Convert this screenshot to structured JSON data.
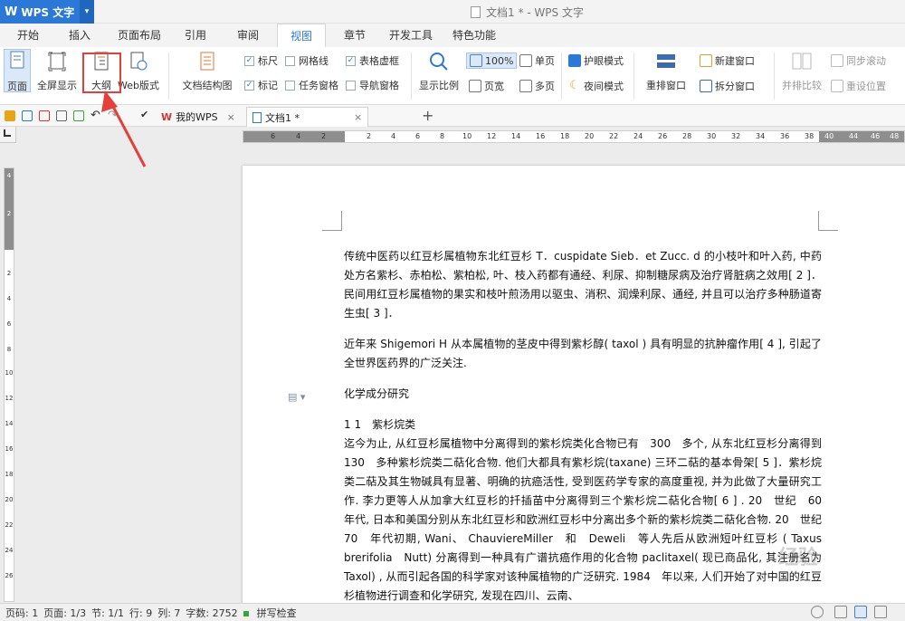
{
  "app": {
    "name": "WPS 文字",
    "window_title": "文档1 * - WPS 文字"
  },
  "tabs": [
    "开始",
    "插入",
    "页面布局",
    "引用",
    "审阅",
    "视图",
    "章节",
    "开发工具",
    "特色功能"
  ],
  "ribbon": {
    "page_view": "页面",
    "fullscreen": "全屏显示",
    "outline": "大纲",
    "web_layout": "Web版式",
    "doc_map": "文档结构图",
    "ruler": "标尺",
    "gridlines": "网格线",
    "table_gridlines": "表格虚框",
    "marks": "标记",
    "task_pane": "任务窗格",
    "nav_pane": "导航窗格",
    "zoom_ratio": "显示比例",
    "zoom_100": "100%",
    "page_width": "页宽",
    "single_page": "单页",
    "multi_page": "多页",
    "eye_protect": "护眼模式",
    "night_mode": "夜间模式",
    "rearrange": "重排窗口",
    "new_window": "新建窗口",
    "split_window": "拆分窗口",
    "side_by_side": "并排比较",
    "sync_scroll": "同步滚动",
    "reset_pos": "重设位置"
  },
  "quickbar": {
    "tab1": "我的WPS",
    "tab2": "文档1 *",
    "close": "×",
    "add": "+"
  },
  "ruler": {
    "h_numbers": [
      "6",
      "4",
      "2",
      "2",
      "4",
      "6",
      "8",
      "10",
      "12",
      "14",
      "16",
      "18",
      "20",
      "22",
      "24",
      "26",
      "28",
      "30",
      "32",
      "34",
      "36",
      "38",
      "40",
      "44",
      "46",
      "48"
    ],
    "v_numbers": [
      "4",
      "2",
      "2",
      "4",
      "6",
      "8",
      "10",
      "12",
      "14",
      "16",
      "18",
      "20",
      "22",
      "24",
      "26"
    ]
  },
  "document": {
    "p1": "传统中医药以红豆杉属植物东北红豆杉 T．cuspidate Sieb．et Zucc. d 的小枝叶和叶入药, 中药处方名紫杉、赤柏松、紫柏松, 叶、枝入药都有通经、利尿、抑制糖尿病及治疗肾脏病之效用[ 2 ]．民间用红豆杉属植物的果实和枝叶煎汤用以驱虫、消积、润燥利尿、通经, 并且可以治疗多种肠道寄生虫[ 3 ]．",
    "p2": "近年来 Shigemori H 从本属植物的茎皮中得到紫杉醇( taxol ) 具有明显的抗肿瘤作用[ 4 ], 引起了全世界医药界的广泛关注.",
    "heading": "化学成分研究",
    "subheading": "1 1　紫杉烷类",
    "p3": "迄今为止, 从红豆杉属植物中分离得到的紫杉烷类化合物已有　300　多个, 从东北红豆杉分离得到　130　多种紫杉烷类二萜化合物. 他们大都具有紫杉烷(taxane) 三环二萜的基本骨架[ 5 ]．紫杉烷类二萜及其生物碱具有显著、明确的抗癌活性, 受到医药学专家的高度重视, 并为此做了大量研究工作. 李力更等人从加拿大红豆杉的扦插苗中分离得到三个紫杉烷二萜化合物[ 6 ] . 20　世纪　60　年代, 日本和美国分别从东北红豆杉和欧洲红豆杉中分离出多个新的紫杉烷类二萜化合物. 20　世纪　70　年代初期, Wani、 ChauviereMiller　和　Deweli　等人先后从欧洲短叶红豆杉 ( Taxus brerifolia　Nutt) 分离得到一种具有广谱抗癌作用的化合物 paclitaxel( 现已商品化, 其注册名为 Taxol) , 从而引起各国的科学家对该种属植物的广泛研究. 1984　年以来, 人们开始了对中国的红豆杉植物进行调查和化学研究, 发现在四川、云南、"
  },
  "status": {
    "page_code": "页码: 1",
    "pages": "页面: 1/3",
    "section": "节: 1/1",
    "row": "行: 9",
    "col": "列: 7",
    "words": "字数: 2752",
    "spellcheck": "拼写检查"
  },
  "watermark": "经验",
  "colors": {
    "accent": "#2b78d7",
    "annotation": "#e4403a"
  }
}
